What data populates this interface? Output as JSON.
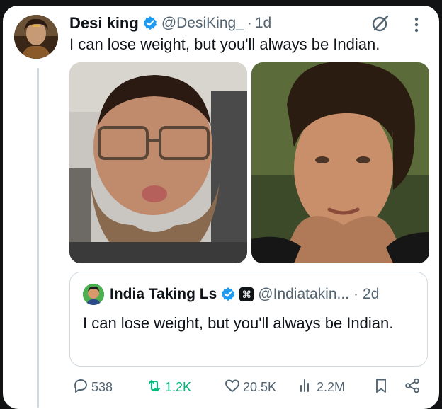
{
  "tweet": {
    "author_name": "Desi king",
    "handle": "@DesiKing_",
    "separator": "·",
    "time": "1d",
    "text": "I can lose weight, but you'll always be Indian."
  },
  "quote": {
    "author_name": "India Taking Ls",
    "handle": "@Indiatakin...",
    "separator": "·",
    "time": "2d",
    "text": "I can lose weight, but you'll always be Indian."
  },
  "actions": {
    "replies": "538",
    "reposts": "1.2K",
    "likes": "20.5K",
    "views": "2.2M"
  },
  "icons": {
    "verified": "verified-badge-icon",
    "grok": "grok-icon",
    "more": "more-vertical-icon",
    "reply": "reply-icon",
    "repost": "repost-icon",
    "like": "heart-icon",
    "views": "bar-chart-icon",
    "bookmark": "bookmark-icon",
    "share": "share-icon",
    "affiliate": "affiliate-badge-icon"
  },
  "colors": {
    "verified": "#1d9bf0",
    "repost": "#00ba7c",
    "muted": "#536471",
    "text": "#0f1419"
  }
}
